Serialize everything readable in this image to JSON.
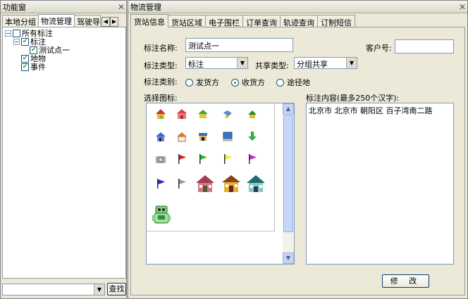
{
  "left_panel": {
    "title": "功能窗",
    "tabs": [
      "本地分组",
      "物流管理",
      "驾驶导"
    ],
    "tree": [
      {
        "label": "所有标注",
        "checked": false,
        "expanded": true
      },
      {
        "label": "标注",
        "checked": true,
        "expanded": true
      },
      {
        "label": "测试点一",
        "checked": true
      },
      {
        "label": "地物",
        "checked": true
      },
      {
        "label": "事件",
        "checked": true
      }
    ],
    "search_value": "",
    "search_button": "查找"
  },
  "right_panel": {
    "title": "物流管理",
    "tabs": [
      "货站信息",
      "货站区域",
      "电子围栏",
      "订单查询",
      "轨迹查询",
      "订制短信"
    ],
    "form": {
      "name_label": "标注名称:",
      "name_value": "测试点一",
      "customer_label": "客户号:",
      "customer_value": "",
      "type_label": "标注类型:",
      "type_value": "标注",
      "share_label": "共享类型:",
      "share_value": "分组共享",
      "category_label": "标注类别:",
      "categories": [
        "发货方",
        "收货方",
        "途径地"
      ],
      "category_selected": "收货方",
      "icon_label": "选择图标:",
      "content_label": "标注内容(最多250个汉字):",
      "content_value": "北京市 北京市 朝阳区 百子湾南二路",
      "modify_button": "修 改"
    },
    "icons": [
      "house-yellow-icon",
      "house-red-icon",
      "house-green-icon",
      "bird-icon",
      "house-small-icon",
      "house-blue-icon",
      "house-orange-icon",
      "hut-icon",
      "computer-icon",
      "arrow-down-icon",
      "camera-icon",
      "flag-red-icon",
      "flag-green-icon",
      "flag-yellow-icon",
      "flag-magenta-icon",
      "flag-blue-icon",
      "flag-gray-icon",
      "house-pink-big-icon",
      "house-brown-big-icon",
      "house-teal-big-icon",
      "robot-icon"
    ]
  }
}
